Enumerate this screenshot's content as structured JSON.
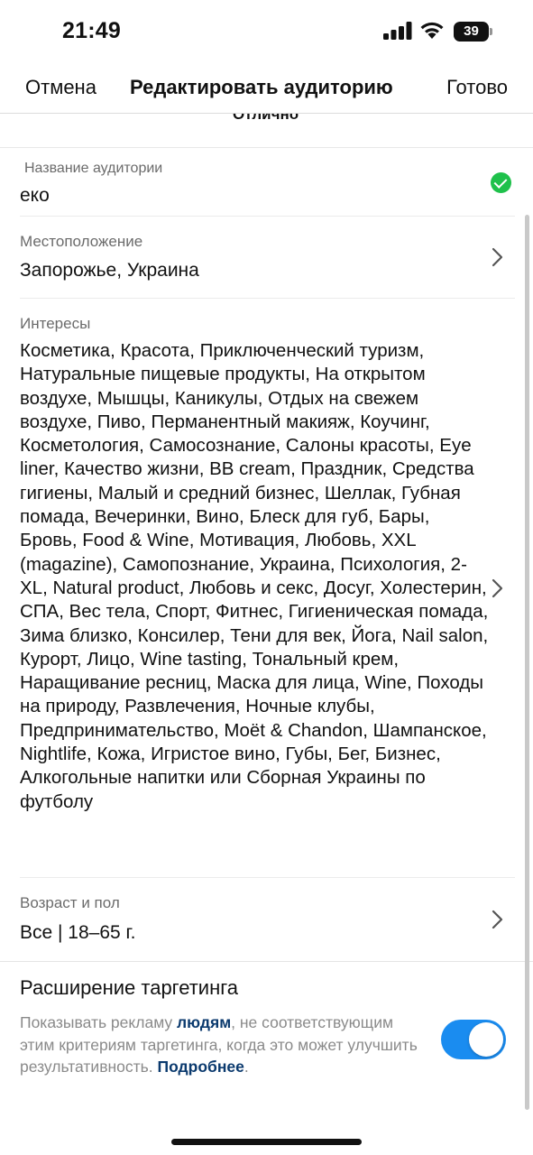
{
  "status_bar": {
    "time": "21:49",
    "battery": "39",
    "icons": [
      "cellular-signal-icon",
      "wifi-icon",
      "battery-icon"
    ]
  },
  "nav": {
    "cancel": "Отмена",
    "title": "Редактировать аудиторию",
    "done": "Готово"
  },
  "cutoff_text": "Отлично",
  "fields": {
    "name": {
      "label": "Название аудитории",
      "value": "еко",
      "status_icon": "check-circle-icon"
    },
    "location": {
      "label": "Местоположение",
      "value": "Запорожье, Украина"
    },
    "interests": {
      "label": "Интересы",
      "value": "Косметика, Красота, Приключенческий туризм, Натуральные пищевые продукты, На открытом воздухе, Мышцы, Каникулы, Отдых на свежем воздухе, Пиво, Перманентный макияж, Коучинг, Косметология, Самосознание, Салоны красоты, Eye liner, Качество жизни, BB cream, Праздник, Средства гигиены, Малый и средний бизнес, Шеллак, Губная помада, Вечеринки, Вино, Блеск для губ, Бары, Бровь, Food & Wine, Мотивация, Любовь, XXL (magazine), Самопознание, Украина, Психология, 2-XL, Natural product, Любовь и секс, Досуг, Холестерин, СПА, Вес тела, Спорт, Фитнес, Гигиеническая помада, Зима близко, Консилер, Тени для век, Йога, Nail salon, Курорт, Лицо, Wine tasting, Тональный крем, Наращивание ресниц, Маска для лица, Wine, Походы на природу, Развлечения, Ночные клубы, Предпринимательство, Moët & Chandon, Шампанское, Nightlife, Кожа, Игристое вино, Губы, Бег, Бизнес, Алкогольные напитки или Сборная Украины по футболу"
    },
    "age_gender": {
      "label": "Возраст и пол",
      "value": "Все | 18–65 г."
    }
  },
  "targeting_expansion": {
    "title": "Расширение таргетинга",
    "desc_part1": "Показывать рекламу ",
    "desc_link": "людям",
    "desc_part2": ", не соответствующим этим критериям таргетинга, когда это может улучшить результативность. ",
    "more_link": "Подробнее",
    "period": ".",
    "toggle_on": true,
    "toggle_color": "#1a8cf0"
  },
  "colors": {
    "check_green": "#1fc14b",
    "link_blue": "#0b3a6e",
    "label_gray": "#6b6b6b"
  }
}
